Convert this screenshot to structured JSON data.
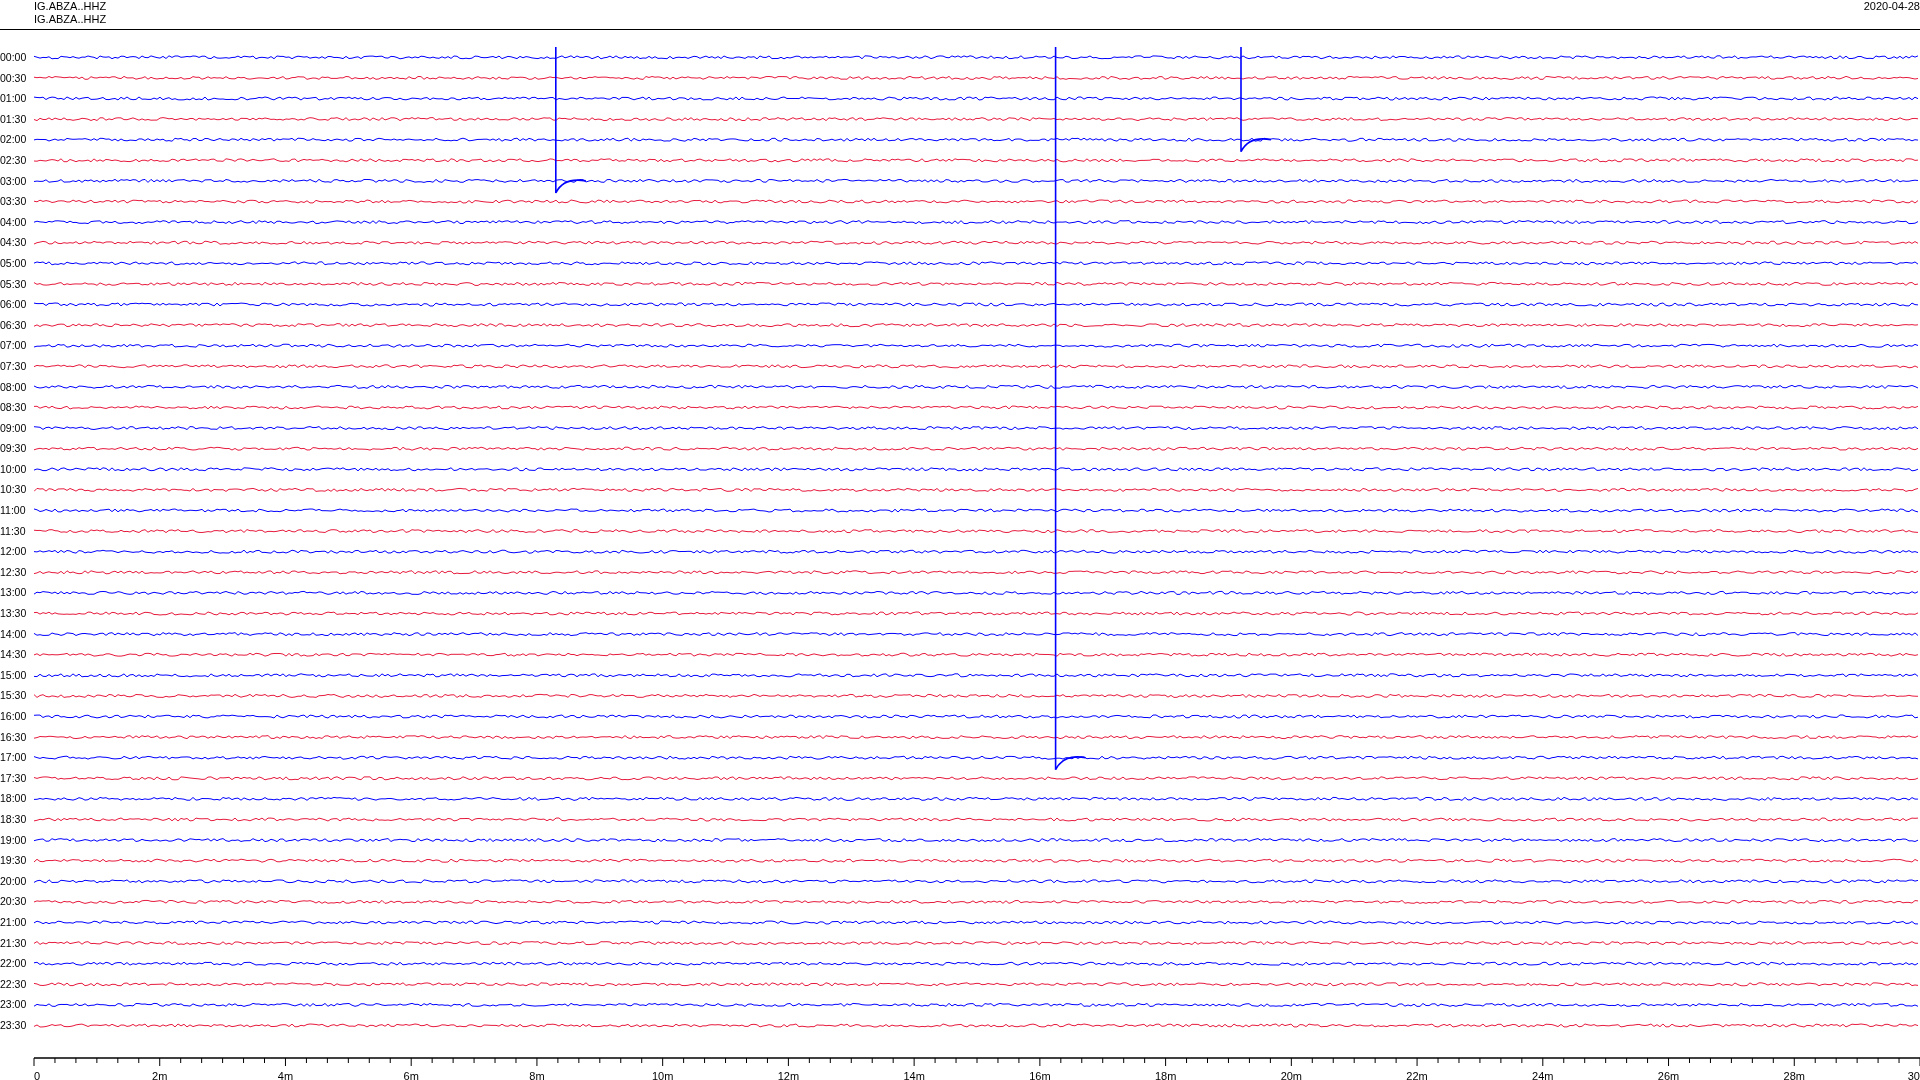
{
  "header": {
    "station_lines": [
      "IG.ABZA..HHZ",
      "IG.ABZA..HHZ"
    ],
    "date": "2020-04-28"
  },
  "rows": [
    {
      "time": "00:00",
      "color": "#0000ff"
    },
    {
      "time": "00:30",
      "color": "#e6193c"
    },
    {
      "time": "01:00",
      "color": "#0000ff"
    },
    {
      "time": "01:30",
      "color": "#e6193c"
    },
    {
      "time": "02:00",
      "color": "#0000ff"
    },
    {
      "time": "02:30",
      "color": "#e6193c"
    },
    {
      "time": "03:00",
      "color": "#0000ff"
    },
    {
      "time": "03:30",
      "color": "#e6193c"
    },
    {
      "time": "04:00",
      "color": "#0000ff"
    },
    {
      "time": "04:30",
      "color": "#e6193c"
    },
    {
      "time": "05:00",
      "color": "#0000ff"
    },
    {
      "time": "05:30",
      "color": "#e6193c"
    },
    {
      "time": "06:00",
      "color": "#0000ff"
    },
    {
      "time": "06:30",
      "color": "#e6193c"
    },
    {
      "time": "07:00",
      "color": "#0000ff"
    },
    {
      "time": "07:30",
      "color": "#e6193c"
    },
    {
      "time": "08:00",
      "color": "#0000ff"
    },
    {
      "time": "08:30",
      "color": "#e6193c"
    },
    {
      "time": "09:00",
      "color": "#0000ff"
    },
    {
      "time": "09:30",
      "color": "#e6193c"
    },
    {
      "time": "10:00",
      "color": "#0000ff"
    },
    {
      "time": "10:30",
      "color": "#e6193c"
    },
    {
      "time": "11:00",
      "color": "#0000ff"
    },
    {
      "time": "11:30",
      "color": "#e6193c"
    },
    {
      "time": "12:00",
      "color": "#0000ff"
    },
    {
      "time": "12:30",
      "color": "#e6193c"
    },
    {
      "time": "13:00",
      "color": "#0000ff"
    },
    {
      "time": "13:30",
      "color": "#e6193c"
    },
    {
      "time": "14:00",
      "color": "#0000ff"
    },
    {
      "time": "14:30",
      "color": "#e6193c"
    },
    {
      "time": "15:00",
      "color": "#0000ff"
    },
    {
      "time": "15:30",
      "color": "#e6193c"
    },
    {
      "time": "16:00",
      "color": "#0000ff"
    },
    {
      "time": "16:30",
      "color": "#e6193c"
    },
    {
      "time": "17:00",
      "color": "#0000ff"
    },
    {
      "time": "17:30",
      "color": "#e6193c"
    },
    {
      "time": "18:00",
      "color": "#0000ff"
    },
    {
      "time": "18:30",
      "color": "#e6193c"
    },
    {
      "time": "19:00",
      "color": "#0000ff"
    },
    {
      "time": "19:30",
      "color": "#e6193c"
    },
    {
      "time": "20:00",
      "color": "#0000ff"
    },
    {
      "time": "20:30",
      "color": "#e6193c"
    },
    {
      "time": "21:00",
      "color": "#0000ff"
    },
    {
      "time": "21:30",
      "color": "#e6193c"
    },
    {
      "time": "22:00",
      "color": "#0000ff"
    },
    {
      "time": "22:30",
      "color": "#e6193c"
    },
    {
      "time": "23:00",
      "color": "#0000ff"
    },
    {
      "time": "23:30",
      "color": "#e6193c"
    }
  ],
  "x_axis": {
    "labels": [
      "0",
      "2m",
      "4m",
      "6m",
      "8m",
      "10m",
      "12m",
      "14m",
      "16m",
      "18m",
      "20m",
      "22m",
      "24m",
      "26m",
      "28m",
      "30"
    ]
  }
}
